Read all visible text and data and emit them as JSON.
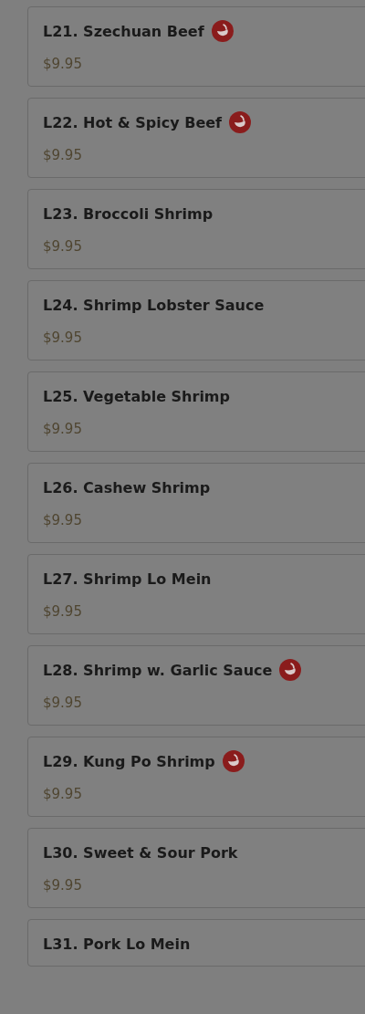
{
  "menu_items": [
    {
      "name": "L21. Szechuan Beef",
      "spicy": true,
      "price": "$9.95"
    },
    {
      "name": "L22. Hot & Spicy Beef",
      "spicy": true,
      "price": "$9.95"
    },
    {
      "name": "L23. Broccoli Shrimp",
      "spicy": false,
      "price": "$9.95"
    },
    {
      "name": "L24. Shrimp Lobster Sauce",
      "spicy": false,
      "price": "$9.95"
    },
    {
      "name": "L25. Vegetable Shrimp",
      "spicy": false,
      "price": "$9.95"
    },
    {
      "name": "L26. Cashew Shrimp",
      "spicy": false,
      "price": "$9.95"
    },
    {
      "name": "L27. Shrimp Lo Mein",
      "spicy": false,
      "price": "$9.95"
    },
    {
      "name": "L28. Shrimp w. Garlic Sauce",
      "spicy": true,
      "price": "$9.95"
    },
    {
      "name": "L29. Kung Po Shrimp",
      "spicy": true,
      "price": "$9.95"
    },
    {
      "name": "L30. Sweet & Sour Pork",
      "spicy": false,
      "price": "$9.95"
    },
    {
      "name": "L31. Pork Lo Mein",
      "spicy": false
    }
  ]
}
